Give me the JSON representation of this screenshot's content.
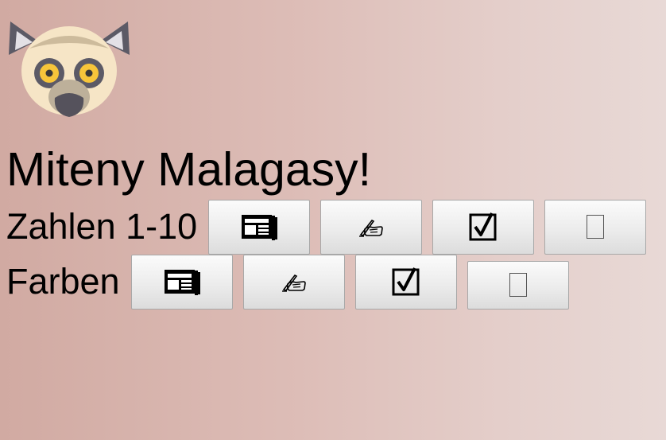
{
  "title": "Miteny Malagasy!",
  "logo": {
    "icon": "lemur-face-icon"
  },
  "rows": [
    {
      "label": "Zahlen 1-10",
      "buttons": [
        {
          "icon": "newspaper-icon"
        },
        {
          "icon": "writing-hand-icon"
        },
        {
          "icon": "ballot-box-check-icon"
        },
        {
          "icon": "empty-box-icon"
        }
      ]
    },
    {
      "label": "Farben",
      "buttons": [
        {
          "icon": "newspaper-icon"
        },
        {
          "icon": "writing-hand-icon"
        },
        {
          "icon": "ballot-box-check-icon"
        },
        {
          "icon": "empty-box-icon"
        }
      ]
    }
  ],
  "colors": {
    "background_left": "#d1aaa2",
    "background_right": "#e8d9d6",
    "lemur_fur": "#f6e5c6",
    "lemur_eye": "#f7c53a",
    "lemur_ears": "#5c5a66"
  }
}
